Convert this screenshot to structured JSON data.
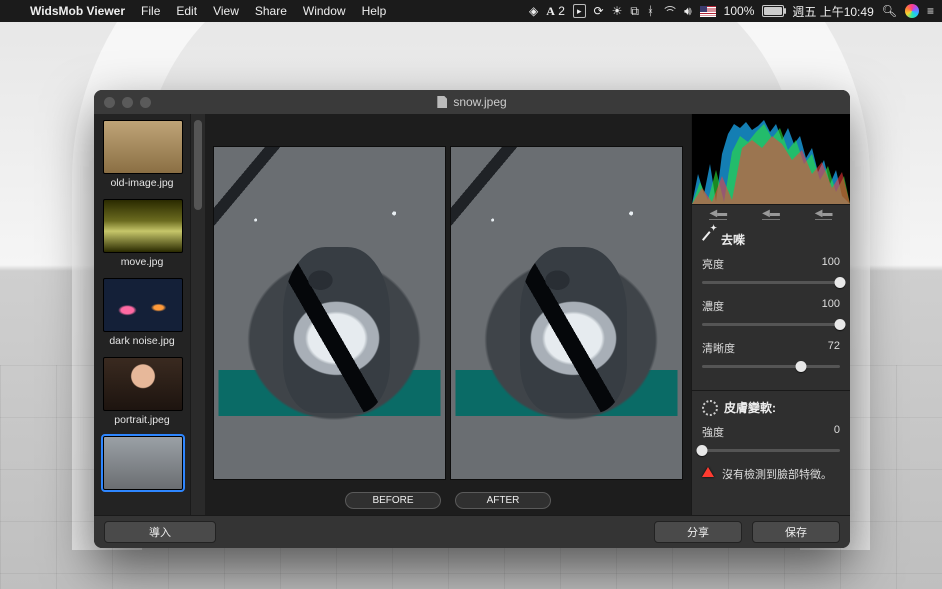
{
  "menubar": {
    "app_name": "WidsMob Viewer",
    "menus": [
      "File",
      "Edit",
      "View",
      "Share",
      "Window",
      "Help"
    ],
    "status": {
      "adobe": "2",
      "battery_pct": "100%",
      "clock": "週五 上午10:49"
    }
  },
  "window": {
    "title": "snow.jpeg"
  },
  "sidebar": {
    "items": [
      {
        "label": "old-image.jpg",
        "kind": "oldimg",
        "selected": false
      },
      {
        "label": "move.jpg",
        "kind": "move",
        "selected": false
      },
      {
        "label": "dark noise.jpg",
        "kind": "darknoise",
        "selected": false
      },
      {
        "label": "portrait.jpeg",
        "kind": "portrait",
        "selected": false
      },
      {
        "label": "",
        "kind": "snow",
        "selected": true
      }
    ]
  },
  "canvas": {
    "before_label": "BEFORE",
    "after_label": "AFTER"
  },
  "panel": {
    "denoise": {
      "title": "去喍",
      "controls": [
        {
          "label": "亮度",
          "value": 100,
          "pct": 100
        },
        {
          "label": "濃度",
          "value": 100,
          "pct": 100
        },
        {
          "label": "清晰度",
          "value": 72,
          "pct": 72
        }
      ]
    },
    "skin": {
      "title": "皮膚變軟:",
      "controls": [
        {
          "label": "強度",
          "value": 0,
          "pct": 0
        }
      ],
      "warning": "沒有檢測到臉部特徵。"
    }
  },
  "footer": {
    "import": "導入",
    "share": "分享",
    "save": "保存"
  }
}
